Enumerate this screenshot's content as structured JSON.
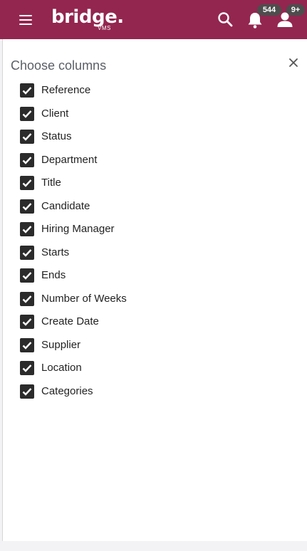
{
  "header": {
    "logo_text": "bridge.",
    "logo_subtext": "VMS",
    "notification_count": "544",
    "user_badge": "9+",
    "icons": [
      "hamburger-icon",
      "search-icon",
      "bell-icon",
      "user-icon"
    ],
    "colors": {
      "brand": "#93264f",
      "badge": "#4d4d4d"
    }
  },
  "panel": {
    "title": "Choose columns",
    "close_icon": "close-icon",
    "columns": [
      {
        "label": "Reference",
        "checked": true
      },
      {
        "label": "Client",
        "checked": true
      },
      {
        "label": "Status",
        "checked": true
      },
      {
        "label": "Department",
        "checked": true
      },
      {
        "label": "Title",
        "checked": true
      },
      {
        "label": "Candidate",
        "checked": true
      },
      {
        "label": "Hiring Manager",
        "checked": true
      },
      {
        "label": "Starts",
        "checked": true
      },
      {
        "label": "Ends",
        "checked": true
      },
      {
        "label": "Number of Weeks",
        "checked": true
      },
      {
        "label": "Create Date",
        "checked": true
      },
      {
        "label": "Supplier",
        "checked": true
      },
      {
        "label": "Location",
        "checked": true
      },
      {
        "label": "Categories",
        "checked": true
      }
    ]
  }
}
